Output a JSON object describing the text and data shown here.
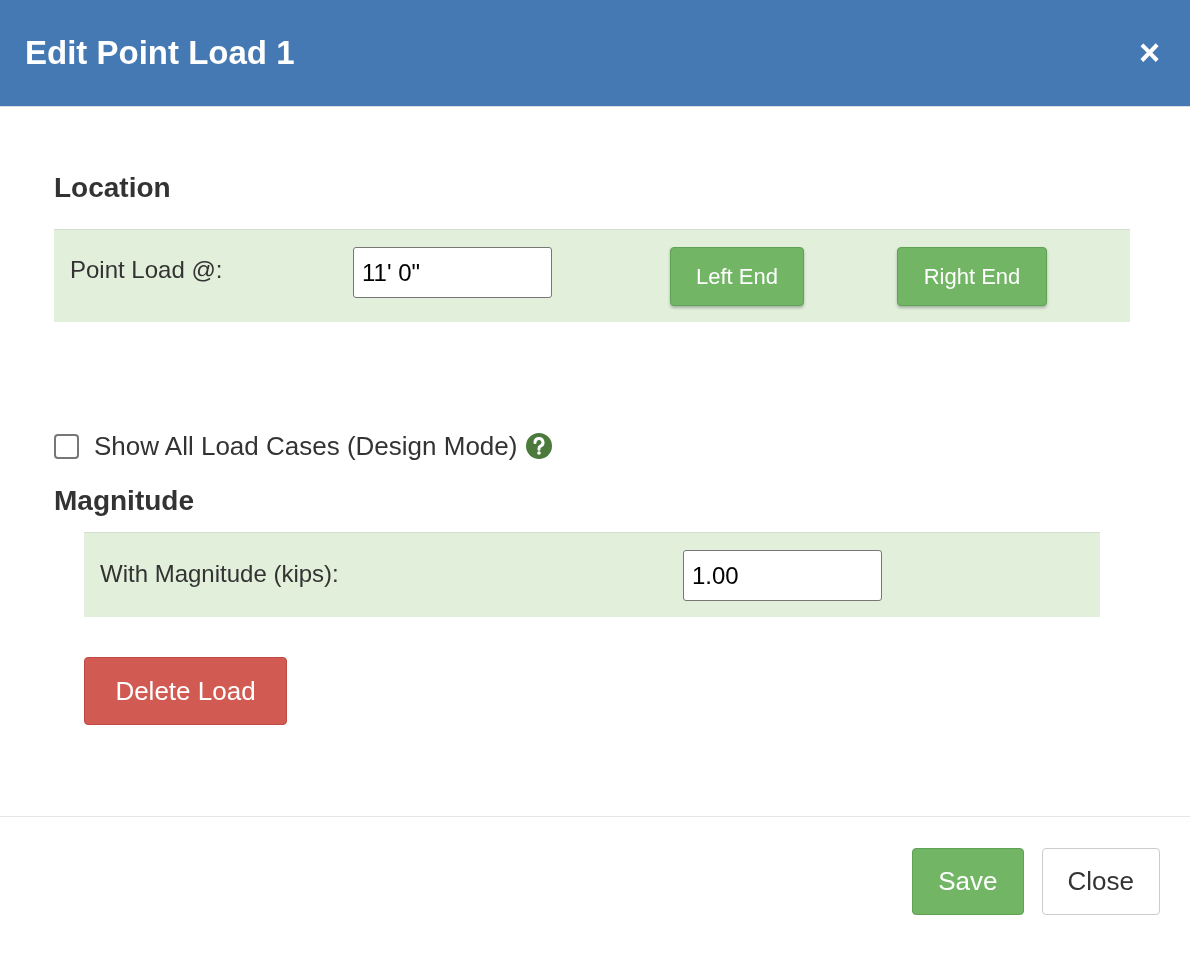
{
  "dialog": {
    "title": "Edit Point Load 1",
    "close": "×"
  },
  "location": {
    "heading": "Location",
    "label": "Point Load @:",
    "value": "11' 0\"",
    "buttons": [
      "Left End",
      "Right End"
    ]
  },
  "show_all": {
    "label": "Show All Load Cases (Design Mode)",
    "checked": false
  },
  "magnitude": {
    "heading": "Magnitude",
    "label": "With Magnitude (kips):",
    "value": "1.00"
  },
  "delete_button": "Delete Load",
  "footer": [
    {
      "label": "Save",
      "kind": "primary"
    },
    {
      "label": "Close",
      "kind": "default"
    }
  ]
}
